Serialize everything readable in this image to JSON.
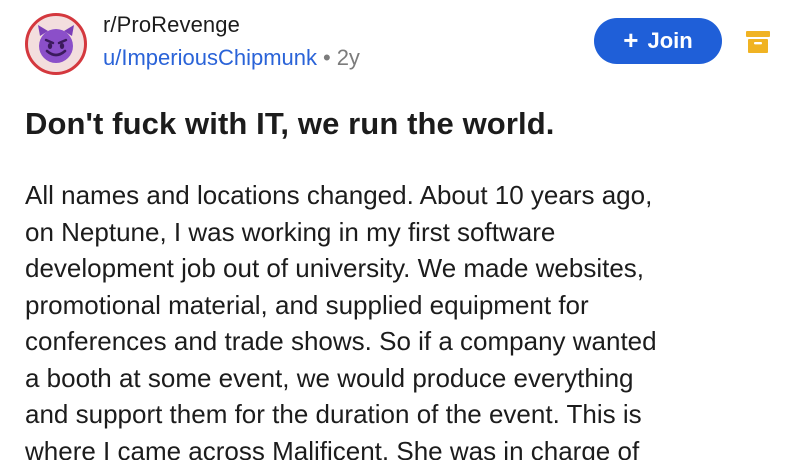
{
  "post": {
    "subreddit": "r/ProRevenge",
    "username": "u/ImperiousChipmunk",
    "separator": "•",
    "age": "2y",
    "title": "Don't fuck with IT, we run the world.",
    "body_lines": [
      "All names and locations changed. About 10 years ago,",
      "on Neptune, I was working in my first software",
      "development job out of university. We made websites,",
      "promotional material, and supplied equipment for",
      "conferences and trade shows. So if a company wanted",
      "a booth at some event, we would produce everything",
      "and support them for the duration of the event. This is",
      "where I came across Malificent. She was in charge of"
    ]
  },
  "actions": {
    "join_plus": "+",
    "join_label": "Join"
  },
  "icons": {
    "avatar": "devil-face-icon",
    "archive": "archive-icon"
  },
  "colors": {
    "join_button": "#1f5fd8",
    "username_link": "#2a63d8",
    "archive_icon": "#f0b323",
    "avatar_face": "#8b4fc9"
  }
}
